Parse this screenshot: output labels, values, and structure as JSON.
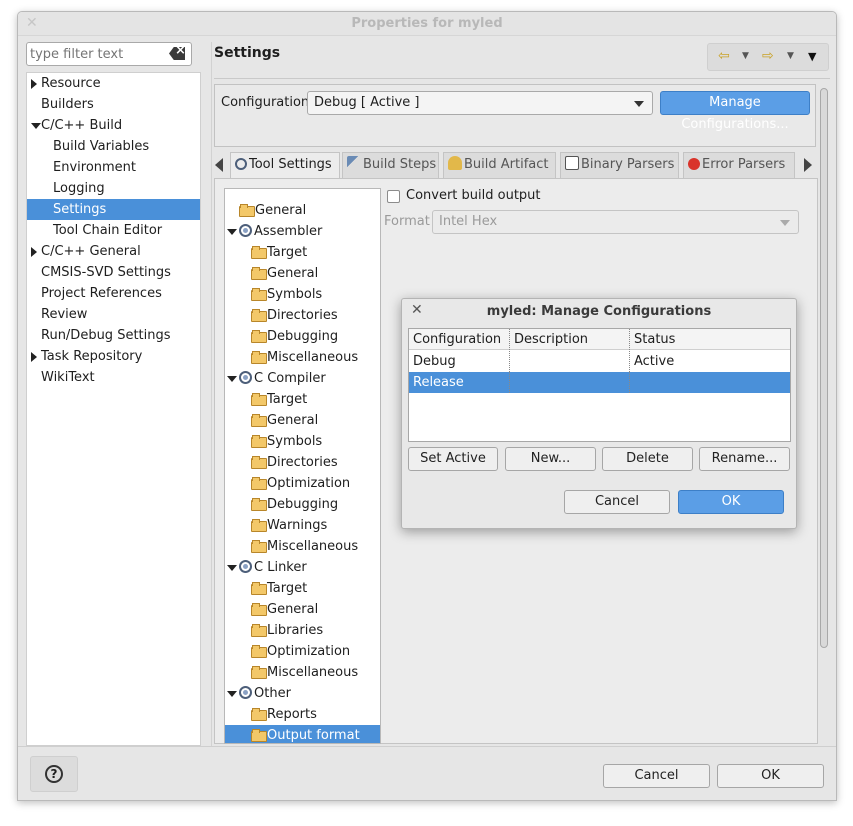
{
  "window": {
    "title": "Properties for myled",
    "close_glyph": "✕"
  },
  "filter": {
    "placeholder": "type filter text"
  },
  "nav": {
    "items": [
      {
        "label": "Resource",
        "arrow": "right",
        "indent": 0
      },
      {
        "label": "Builders",
        "arrow": "",
        "indent": 0
      },
      {
        "label": "C/C++ Build",
        "arrow": "down",
        "indent": 0
      },
      {
        "label": "Build Variables",
        "arrow": "",
        "indent": 1
      },
      {
        "label": "Environment",
        "arrow": "",
        "indent": 1
      },
      {
        "label": "Logging",
        "arrow": "",
        "indent": 1
      },
      {
        "label": "Settings",
        "arrow": "",
        "indent": 1,
        "selected": true
      },
      {
        "label": "Tool Chain Editor",
        "arrow": "",
        "indent": 1
      },
      {
        "label": "C/C++ General",
        "arrow": "right",
        "indent": 0
      },
      {
        "label": "CMSIS-SVD Settings",
        "arrow": "",
        "indent": 0
      },
      {
        "label": "Project References",
        "arrow": "",
        "indent": 0
      },
      {
        "label": "Review",
        "arrow": "",
        "indent": 0
      },
      {
        "label": "Run/Debug Settings",
        "arrow": "",
        "indent": 0
      },
      {
        "label": "Task Repository",
        "arrow": "right",
        "indent": 0
      },
      {
        "label": "WikiText",
        "arrow": "",
        "indent": 0
      }
    ]
  },
  "page": {
    "title": "Settings"
  },
  "config": {
    "label": "Configuration:",
    "value": "Debug  [ Active ]",
    "manage_label": "Manage Configurations..."
  },
  "tabs": [
    {
      "label": "Tool Settings",
      "icon": "tool-settings-icon",
      "active": true
    },
    {
      "label": "Build Steps",
      "icon": "build-steps-icon"
    },
    {
      "label": "Build Artifact",
      "icon": "build-artifact-icon"
    },
    {
      "label": "Binary Parsers",
      "icon": "binary-parsers-icon"
    },
    {
      "label": "Error Parsers",
      "icon": "error-parsers-icon"
    }
  ],
  "tooltree": [
    {
      "label": "General",
      "level": 0,
      "icon": "folder"
    },
    {
      "label": "Assembler",
      "level": 0,
      "icon": "gear",
      "expanded": true
    },
    {
      "label": "Target",
      "level": 1,
      "icon": "folder"
    },
    {
      "label": "General",
      "level": 1,
      "icon": "folder"
    },
    {
      "label": "Symbols",
      "level": 1,
      "icon": "folder"
    },
    {
      "label": "Directories",
      "level": 1,
      "icon": "folder"
    },
    {
      "label": "Debugging",
      "level": 1,
      "icon": "folder"
    },
    {
      "label": "Miscellaneous",
      "level": 1,
      "icon": "folder"
    },
    {
      "label": "C Compiler",
      "level": 0,
      "icon": "gear",
      "expanded": true
    },
    {
      "label": "Target",
      "level": 1,
      "icon": "folder"
    },
    {
      "label": "General",
      "level": 1,
      "icon": "folder"
    },
    {
      "label": "Symbols",
      "level": 1,
      "icon": "folder"
    },
    {
      "label": "Directories",
      "level": 1,
      "icon": "folder"
    },
    {
      "label": "Optimization",
      "level": 1,
      "icon": "folder"
    },
    {
      "label": "Debugging",
      "level": 1,
      "icon": "folder"
    },
    {
      "label": "Warnings",
      "level": 1,
      "icon": "folder"
    },
    {
      "label": "Miscellaneous",
      "level": 1,
      "icon": "folder"
    },
    {
      "label": "C Linker",
      "level": 0,
      "icon": "gear",
      "expanded": true
    },
    {
      "label": "Target",
      "level": 1,
      "icon": "folder"
    },
    {
      "label": "General",
      "level": 1,
      "icon": "folder"
    },
    {
      "label": "Libraries",
      "level": 1,
      "icon": "folder"
    },
    {
      "label": "Optimization",
      "level": 1,
      "icon": "folder"
    },
    {
      "label": "Miscellaneous",
      "level": 1,
      "icon": "folder"
    },
    {
      "label": "Other",
      "level": 0,
      "icon": "gear",
      "expanded": true
    },
    {
      "label": "Reports",
      "level": 1,
      "icon": "folder"
    },
    {
      "label": "Output format",
      "level": 1,
      "icon": "folder",
      "selected": true
    }
  ],
  "output": {
    "convert_label": "Convert build output",
    "format_label": "Format",
    "format_value": "Intel Hex"
  },
  "dialog": {
    "title": "myled: Manage Configurations",
    "close_glyph": "✕",
    "columns": [
      "Configuration",
      "Description",
      "Status"
    ],
    "rows": [
      {
        "configuration": "Debug",
        "description": "",
        "status": "Active"
      },
      {
        "configuration": "Release",
        "description": "",
        "status": "",
        "selected": true
      }
    ],
    "set_active": "Set Active",
    "new": "New...",
    "delete": "Delete",
    "rename": "Rename...",
    "cancel": "Cancel",
    "ok": "OK"
  },
  "footer": {
    "cancel": "Cancel",
    "ok": "OK",
    "help_glyph": "?"
  },
  "colors": {
    "selection": "#4a90d9",
    "primary_button": "#5b9ee6"
  }
}
